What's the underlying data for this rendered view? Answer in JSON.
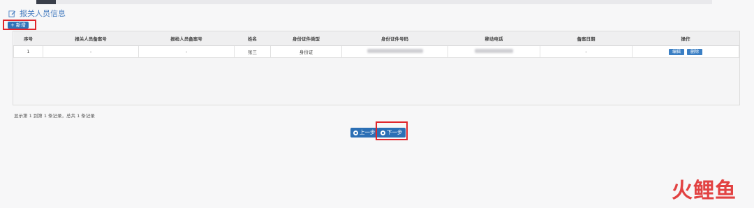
{
  "header": {
    "section_title": "报关人员信息",
    "add_label": "新增"
  },
  "grid": {
    "columns": [
      "序号",
      "报关人员备案号",
      "报检人员备案号",
      "姓名",
      "身份证件类型",
      "身份证件号码",
      "移动电话",
      "备案日期",
      "操作"
    ],
    "rows": [
      {
        "index": "1",
        "customs_no": "-",
        "inspection_no": "-",
        "name": "张三",
        "id_type": "身份证",
        "date": "-"
      }
    ],
    "edit_label": "编辑",
    "delete_label": "删除"
  },
  "pager": {
    "info": "显示第 1 到第 1 条记录，总共 1 条记录"
  },
  "nav": {
    "prev_label": "上一步",
    "next_label": "下一步"
  },
  "watermark": {
    "text": "火鲤鱼"
  },
  "colors": {
    "accent": "#2b6fb5",
    "highlight": "#e0262c"
  }
}
